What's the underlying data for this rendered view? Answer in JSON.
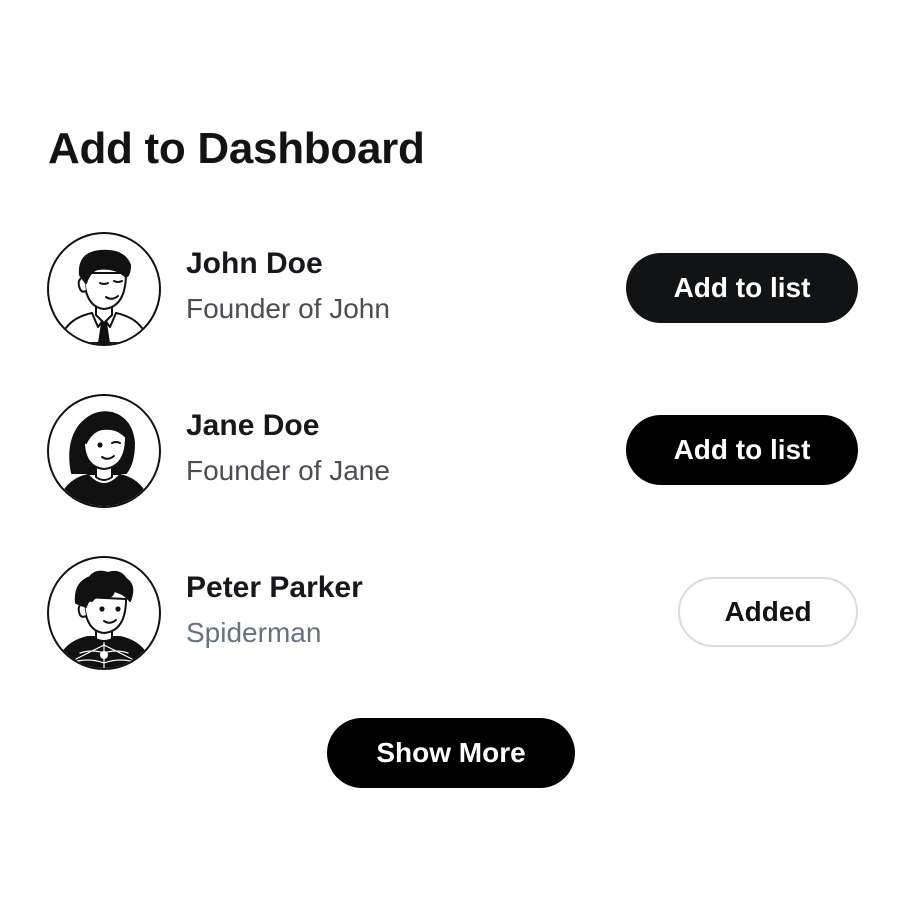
{
  "page": {
    "title": "Add to Dashboard"
  },
  "people": [
    {
      "name": "John Doe",
      "subtitle": "Founder of John",
      "action": "Add to list",
      "avatar_icon": "man-with-tie-avatar-icon"
    },
    {
      "name": "Jane Doe",
      "subtitle": "Founder of Jane",
      "action": "Add to list",
      "avatar_icon": "woman-avatar-icon"
    },
    {
      "name": "Peter Parker",
      "subtitle": "Spiderman",
      "action": "Added",
      "avatar_icon": "spiderman-avatar-icon"
    }
  ],
  "footer": {
    "show_more_label": "Show More"
  },
  "colors": {
    "primary_button": "#111315",
    "text": "#16181b",
    "muted_text": "#667380",
    "added_border": "#d9dbde"
  }
}
